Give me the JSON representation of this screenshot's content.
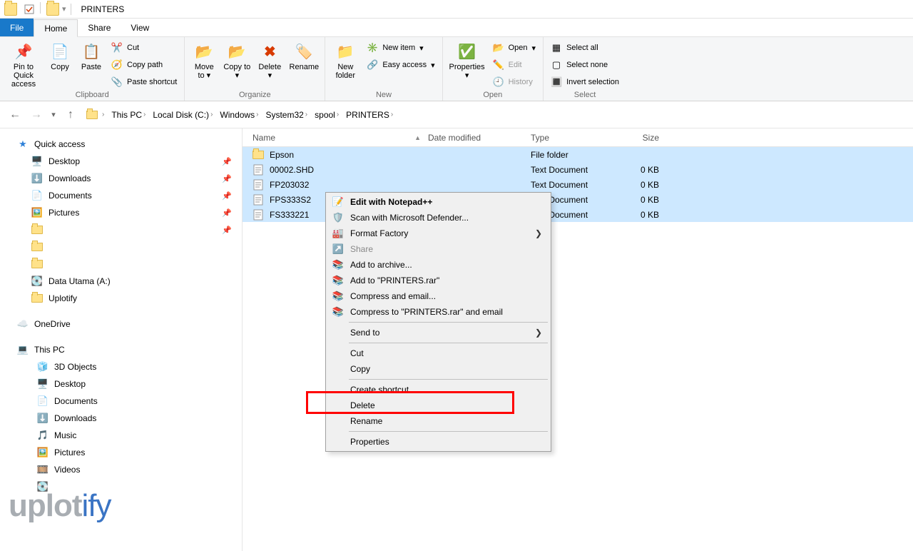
{
  "title": "PRINTERS",
  "qat": {
    "dropdown": "▾"
  },
  "tabs": {
    "file": "File",
    "home": "Home",
    "share": "Share",
    "view": "View"
  },
  "ribbon": {
    "clipboard": {
      "label": "Clipboard",
      "pin": "Pin to Quick access",
      "copy": "Copy",
      "paste": "Paste",
      "cut": "Cut",
      "copy_path": "Copy path",
      "paste_shortcut": "Paste shortcut"
    },
    "organize": {
      "label": "Organize",
      "move_to": "Move to",
      "copy_to": "Copy to",
      "delete": "Delete",
      "rename": "Rename"
    },
    "new": {
      "label": "New",
      "new_folder": "New folder",
      "new_item": "New item",
      "easy_access": "Easy access"
    },
    "open": {
      "label": "Open",
      "properties": "Properties",
      "open": "Open",
      "edit": "Edit",
      "history": "History"
    },
    "select": {
      "label": "Select",
      "select_all": "Select all",
      "select_none": "Select none",
      "invert": "Invert selection"
    }
  },
  "breadcrumb": {
    "items": [
      "This PC",
      "Local Disk (C:)",
      "Windows",
      "System32",
      "spool",
      "PRINTERS"
    ]
  },
  "columns": {
    "name": "Name",
    "modified": "Date modified",
    "type": "Type",
    "size": "Size"
  },
  "files": [
    {
      "name": "Epson",
      "type": "File folder",
      "size": "",
      "icon": "folder"
    },
    {
      "name": "00002.SHD",
      "type": "Text Document",
      "size": "0 KB",
      "icon": "txt"
    },
    {
      "name": "FP203032",
      "type": "Text Document",
      "size": "0 KB",
      "icon": "txt"
    },
    {
      "name": "FPS333S2",
      "type": "Text Document",
      "size": "0 KB",
      "icon": "txt"
    },
    {
      "name": "FS333221",
      "type": "Text Document",
      "size": "0 KB",
      "icon": "txt"
    }
  ],
  "sidebar": {
    "quick_access": "Quick access",
    "qa_items": [
      {
        "label": "Desktop",
        "icon": "desk"
      },
      {
        "label": "Downloads",
        "icon": "down"
      },
      {
        "label": "Documents",
        "icon": "doc"
      },
      {
        "label": "Pictures",
        "icon": "pic"
      }
    ],
    "data_utama": "Data Utama (A:)",
    "uplotify": "Uplotify",
    "onedrive": "OneDrive",
    "this_pc": "This PC",
    "pc_items": [
      {
        "label": "3D Objects"
      },
      {
        "label": "Desktop"
      },
      {
        "label": "Documents"
      },
      {
        "label": "Downloads"
      },
      {
        "label": "Music"
      },
      {
        "label": "Pictures"
      },
      {
        "label": "Videos"
      }
    ]
  },
  "context_menu": {
    "edit_npp": "Edit with Notepad++",
    "scan_defender": "Scan with Microsoft Defender...",
    "format_factory": "Format Factory",
    "share": "Share",
    "add_archive": "Add to archive...",
    "add_printers_rar": "Add to \"PRINTERS.rar\"",
    "compress_email": "Compress and email...",
    "compress_printers_email": "Compress to \"PRINTERS.rar\" and email",
    "send_to": "Send to",
    "cut": "Cut",
    "copy": "Copy",
    "create_shortcut": "Create shortcut",
    "delete": "Delete",
    "rename": "Rename",
    "properties": "Properties"
  },
  "watermark": {
    "a": "uplot",
    "b": "ify"
  }
}
